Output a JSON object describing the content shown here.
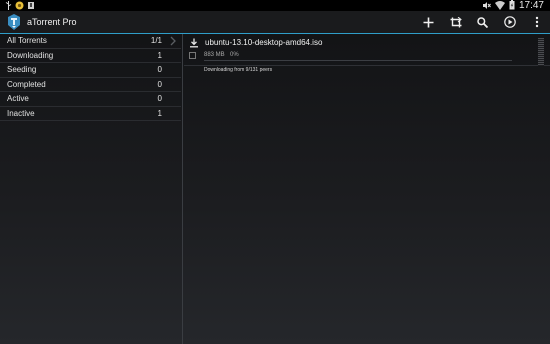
{
  "status_bar": {
    "time": "17:47",
    "icons_left": [
      "usb-icon",
      "notification-icon",
      "download-status-icon"
    ],
    "icons_right": [
      "mute-icon",
      "wifi-icon",
      "battery-icon"
    ]
  },
  "action_bar": {
    "title": "aTorrent Pro",
    "actions": [
      "add-icon",
      "crop-icon",
      "search-icon",
      "play-icon",
      "overflow-menu-icon"
    ]
  },
  "filters": [
    {
      "label": "All Torrents",
      "count": "1/1",
      "selected": true
    },
    {
      "label": "Downloading",
      "count": "1"
    },
    {
      "label": "Seeding",
      "count": "0"
    },
    {
      "label": "Completed",
      "count": "0"
    },
    {
      "label": "Active",
      "count": "0"
    },
    {
      "label": "Inactive",
      "count": "1"
    }
  ],
  "torrents": [
    {
      "name": "ubuntu-13.10-desktop-amd64.iso",
      "size": "883 MB",
      "progress": "0%",
      "progress_value": 0,
      "status": "Downloading from 9/131 peers"
    }
  ],
  "colors": {
    "accent": "#2f9ec9",
    "background": "#1c1d20",
    "text": "#e6e6e6"
  }
}
